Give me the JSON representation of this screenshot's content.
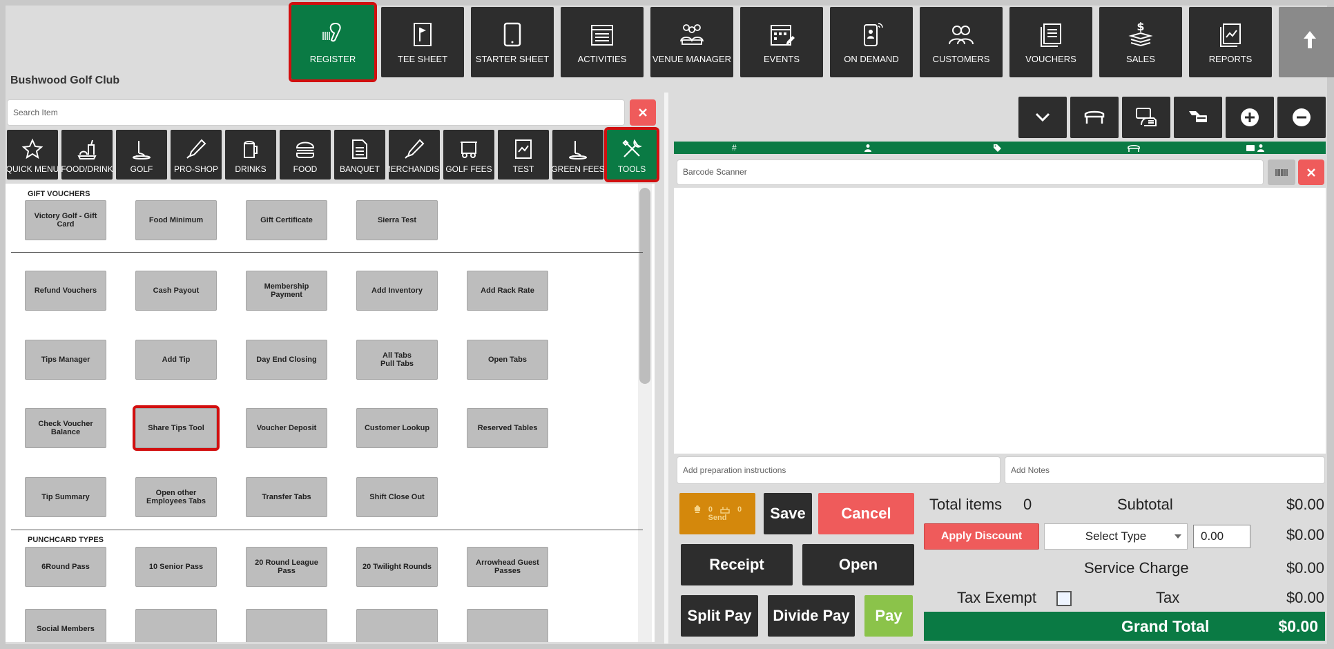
{
  "club_name": "Bushwood Golf Club",
  "nav": [
    {
      "label": "REGISTER",
      "icon": "scanner-icon",
      "active": true
    },
    {
      "label": "TEE SHEET",
      "icon": "flag-sheet-icon"
    },
    {
      "label": "STARTER SHEET",
      "icon": "tablet-icon"
    },
    {
      "label": "ACTIVITIES",
      "icon": "calendar-list-icon"
    },
    {
      "label": "VENUE MANAGER",
      "icon": "meeting-icon"
    },
    {
      "label": "EVENTS",
      "icon": "calendar-edit-icon"
    },
    {
      "label": "ON DEMAND",
      "icon": "phone-icon"
    },
    {
      "label": "CUSTOMERS",
      "icon": "users-icon"
    },
    {
      "label": "VOUCHERS",
      "icon": "vouchers-icon"
    },
    {
      "label": "SALES",
      "icon": "money-icon"
    },
    {
      "label": "REPORTS",
      "icon": "report-icon"
    }
  ],
  "search": {
    "placeholder": "Search Item"
  },
  "categories": [
    {
      "label": "QUICK MENU",
      "icon": "star-icon"
    },
    {
      "label": "FOOD/DRINK",
      "icon": "food-drink-icon"
    },
    {
      "label": "GOLF",
      "icon": "golf-icon"
    },
    {
      "label": "PRO-SHOP",
      "icon": "pro-shop-icon"
    },
    {
      "label": "DRINKS",
      "icon": "beer-icon"
    },
    {
      "label": "FOOD",
      "icon": "burger-icon"
    },
    {
      "label": "BANQUET",
      "icon": "document-icon"
    },
    {
      "label": "MERCHANDISE",
      "icon": "merch-icon"
    },
    {
      "label": "GOLF FEES",
      "icon": "golf-cart-icon"
    },
    {
      "label": "TEST",
      "icon": "chart-doc-icon"
    },
    {
      "label": "GREEN FEES",
      "icon": "golf-icon"
    },
    {
      "label": "TOOLS",
      "icon": "tools-icon",
      "active": true
    }
  ],
  "sections": {
    "gift_vouchers": "GIFT VOUCHERS",
    "punchcard_types": "PUNCHCARD TYPES"
  },
  "gift_tiles": [
    "Victory Golf - Gift Card",
    "Food Minimum",
    "Gift Certificate",
    "Sierra Test"
  ],
  "tool_tiles": [
    [
      "Refund Vouchers",
      "Cash Payout",
      "Membership Payment",
      "Add Inventory",
      "Add Rack Rate"
    ],
    [
      "Tips Manager",
      "Add Tip",
      "Day End Closing",
      "All Tabs\nPull Tabs",
      "Open Tabs"
    ],
    [
      "Check Voucher Balance",
      "Share Tips Tool",
      "Voucher Deposit",
      "Customer Lookup",
      "Reserved Tables"
    ],
    [
      "Tip Summary",
      "Open other Employees Tabs",
      "Transfer Tabs",
      "Shift Close Out"
    ]
  ],
  "punch_tiles": [
    [
      "6Round Pass",
      "10 Senior Pass",
      "20 Round League Pass",
      "20 Twilight Rounds",
      "Arrowhead Guest Passes"
    ],
    [
      "Social Members",
      "",
      "",
      "",
      ""
    ]
  ],
  "order": {
    "barcode_placeholder": "Barcode Scanner",
    "prep_placeholder": "Add preparation instructions",
    "notes_placeholder": "Add Notes"
  },
  "actions": {
    "send_label": "Send",
    "send_count_a": "0",
    "send_count_b": "0",
    "save": "Save",
    "cancel": "Cancel",
    "receipt": "Receipt",
    "open": "Open",
    "split_pay": "Split Pay",
    "divide_pay": "Divide Pay",
    "pay": "Pay"
  },
  "summary": {
    "total_items_label": "Total items",
    "total_items": "0",
    "subtotal_label": "Subtotal",
    "subtotal": "$0.00",
    "apply_discount": "Apply Discount",
    "select_type": "Select Type",
    "discount_value": "0.00",
    "discount_amount": "$0.00",
    "service_charge_label": "Service Charge",
    "service_charge": "$0.00",
    "tax_exempt_label": "Tax Exempt",
    "tax_label": "Tax",
    "tax": "$0.00",
    "grand_total_label": "Grand Total",
    "grand_total": "$0.00"
  },
  "colors": {
    "accent_green": "#0a7a44",
    "highlight_red": "#d20f0f",
    "cancel_red": "#ef5b5b",
    "pay_green": "#8bc34a",
    "send_orange": "#d4880c"
  }
}
